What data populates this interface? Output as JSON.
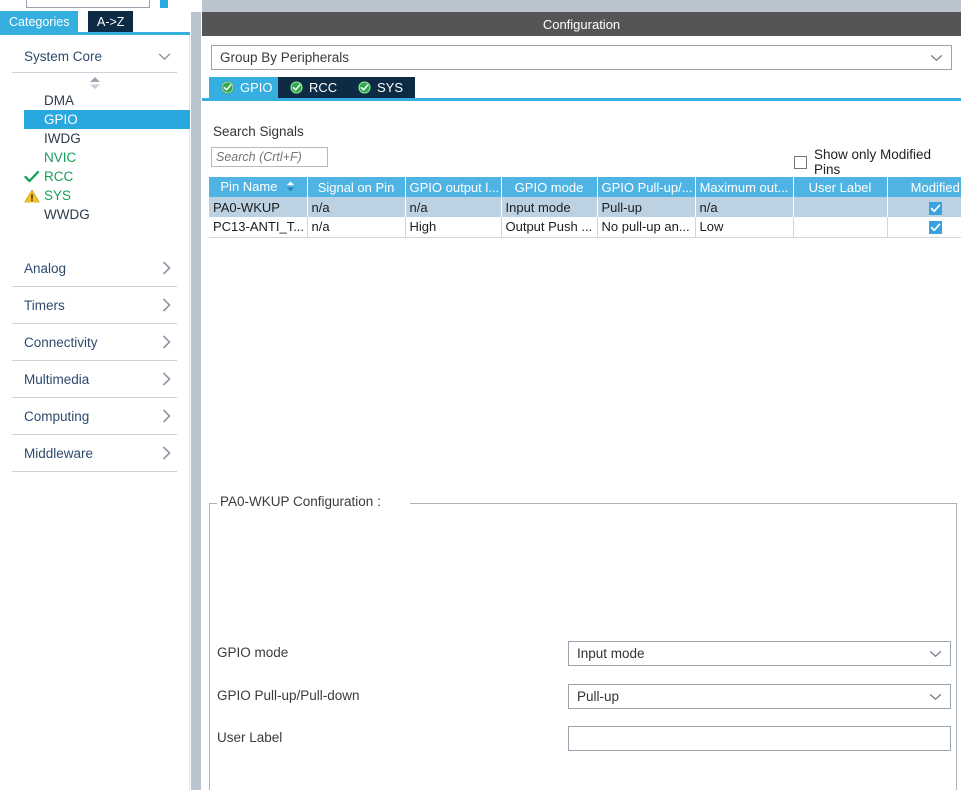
{
  "colors": {
    "accent_cyan": "#34afe0",
    "tab_dark": "#0d2b45",
    "titlebar_gray": "#555555",
    "splitter_gray": "#b9c4ce",
    "table_header": "#4fb4e4",
    "row_selected": "#bcd2e3",
    "green_text": "#17a05a",
    "warn_yellow": "#f2c22a"
  },
  "left_panel": {
    "search_placeholder": "",
    "tabs": [
      {
        "label": "Categories",
        "active": true
      },
      {
        "label": "A->Z",
        "active": false
      }
    ],
    "system_core": {
      "title": "System Core",
      "items": [
        {
          "label": "DMA",
          "state": "none",
          "selected": false
        },
        {
          "label": "GPIO",
          "state": "none",
          "selected": true
        },
        {
          "label": "IWDG",
          "state": "none",
          "selected": false
        },
        {
          "label": "NVIC",
          "state": "green",
          "selected": false
        },
        {
          "label": "RCC",
          "state": "check",
          "selected": false
        },
        {
          "label": "SYS",
          "state": "warning",
          "selected": false
        },
        {
          "label": "WWDG",
          "state": "none",
          "selected": false
        }
      ]
    },
    "groups": [
      {
        "label": "Analog"
      },
      {
        "label": "Timers"
      },
      {
        "label": "Connectivity"
      },
      {
        "label": "Multimedia"
      },
      {
        "label": "Computing"
      },
      {
        "label": "Middleware"
      }
    ]
  },
  "right_panel": {
    "title": "Configuration",
    "group_by": {
      "value": "Group By Peripherals"
    },
    "peripheral_tabs": [
      {
        "label": "GPIO",
        "active": true,
        "status": "ok"
      },
      {
        "label": "RCC",
        "active": false,
        "status": "ok"
      },
      {
        "label": "SYS",
        "active": false,
        "status": "ok"
      }
    ],
    "search": {
      "label": "Search Signals",
      "placeholder": "Search (Crtl+F)",
      "value": ""
    },
    "show_only_modified": {
      "label": "Show only Modified Pins",
      "checked": false
    },
    "table": {
      "columns": [
        "Pin Name",
        "Signal on Pin",
        "GPIO output l...",
        "GPIO mode",
        "GPIO Pull-up/...",
        "Maximum out...",
        "User Label",
        "Modified"
      ],
      "sort_column": "Pin Name",
      "sort_direction": "asc",
      "rows": [
        {
          "selected": true,
          "cells": [
            "PA0-WKUP",
            "n/a",
            "n/a",
            "Input mode",
            "Pull-up",
            "n/a",
            ""
          ],
          "modified": true
        },
        {
          "selected": false,
          "cells": [
            "PC13-ANTI_T...",
            "n/a",
            "High",
            "Output Push ...",
            "No pull-up an...",
            "Low",
            ""
          ],
          "modified": true
        }
      ]
    },
    "pin_config": {
      "legend": "PA0-WKUP Configuration :",
      "fields": [
        {
          "label": "GPIO mode",
          "value": "Input mode",
          "type": "select"
        },
        {
          "label": "GPIO Pull-up/Pull-down",
          "value": "Pull-up",
          "type": "select"
        },
        {
          "label": "User Label",
          "value": "",
          "type": "text"
        }
      ]
    }
  }
}
